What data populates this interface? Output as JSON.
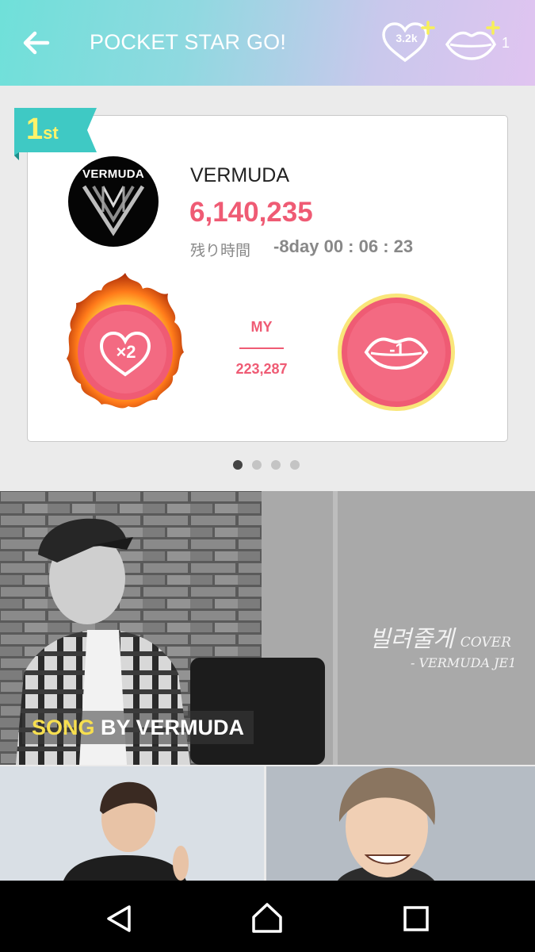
{
  "header": {
    "title": "POCKET STAR GO!",
    "heart_count": "3.2k",
    "lips_count": "1"
  },
  "ranking_card": {
    "rank_number": "1",
    "rank_suffix": "st",
    "artist_logo_text": "VERMUDA",
    "artist_name": "VERMUDA",
    "vote_total": "6,140,235",
    "time_label": "残り時間",
    "time_value": "-8day 00 : 06 : 23",
    "heart_button_label": "×2",
    "my_label": "MY",
    "my_value": "223,287",
    "lips_button_label": "-1"
  },
  "pagination": {
    "total": 4,
    "active": 1
  },
  "banner": {
    "caption_highlight": "SONG",
    "caption_rest": " BY  VERMUDA",
    "cover_title": "빌려줄게",
    "cover_word": "COVER",
    "cover_sub": "- VERMUDA JE1"
  },
  "colors": {
    "accent_pink": "#ef5b74",
    "ribbon_teal": "#3fc9c4",
    "rank_yellow": "#fff36a"
  },
  "icons": [
    "back-arrow-icon",
    "heart-plus-icon",
    "lips-plus-icon",
    "heart-x2-icon",
    "lips-minus-icon",
    "nav-back-icon",
    "nav-home-icon",
    "nav-recent-icon"
  ]
}
